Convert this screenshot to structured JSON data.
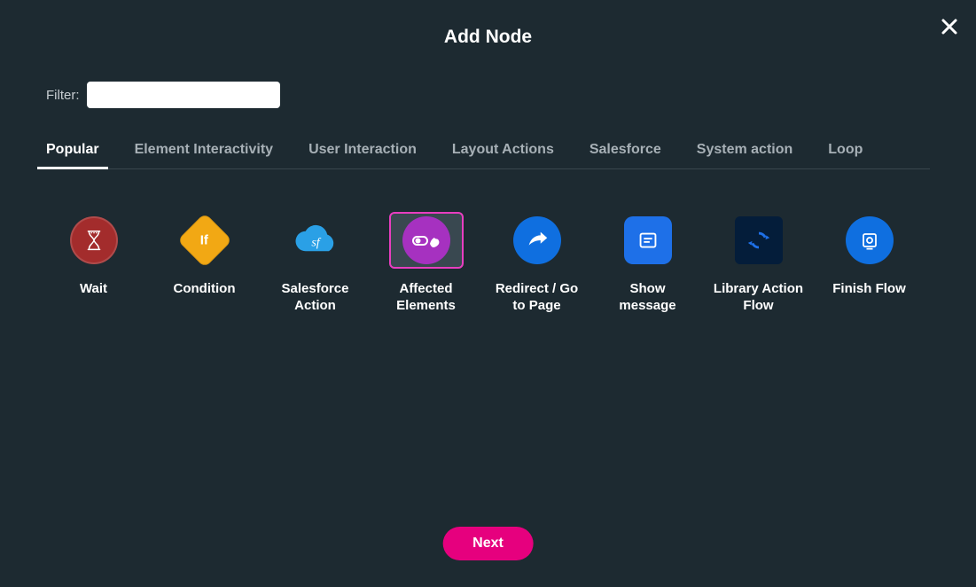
{
  "header": {
    "title": "Add Node"
  },
  "filter": {
    "label": "Filter:",
    "value": ""
  },
  "tabs": [
    {
      "id": "popular",
      "label": "Popular",
      "active": true
    },
    {
      "id": "element-interactivity",
      "label": "Element Interactivity",
      "active": false
    },
    {
      "id": "user-interaction",
      "label": "User Interaction",
      "active": false
    },
    {
      "id": "layout-actions",
      "label": "Layout Actions",
      "active": false
    },
    {
      "id": "salesforce",
      "label": "Salesforce",
      "active": false
    },
    {
      "id": "system-action",
      "label": "System action",
      "active": false
    },
    {
      "id": "loop",
      "label": "Loop",
      "active": false
    }
  ],
  "nodes": [
    {
      "id": "wait",
      "label": "Wait",
      "icon": "hourglass-icon",
      "selected": false
    },
    {
      "id": "condition",
      "label": "Condition",
      "icon": "branch-icon",
      "selected": false
    },
    {
      "id": "salesforce-action",
      "label": "Salesforce Action",
      "icon": "cloud-sf-icon",
      "selected": false
    },
    {
      "id": "affected-elements",
      "label": "Affected Elements",
      "icon": "hand-toggle-icon",
      "selected": true
    },
    {
      "id": "redirect",
      "label": "Redirect / Go to Page",
      "icon": "redirect-arrow-icon",
      "selected": false
    },
    {
      "id": "show-message",
      "label": "Show message",
      "icon": "message-lines-icon",
      "selected": false
    },
    {
      "id": "library-action-flow",
      "label": "Library Action Flow",
      "icon": "sync-arrows-icon",
      "selected": false
    },
    {
      "id": "finish-flow",
      "label": "Finish Flow",
      "icon": "stop-square-icon",
      "selected": false
    }
  ],
  "footer": {
    "next_label": "Next"
  },
  "colors": {
    "background": "#1d2a31",
    "accent": "#e6007e",
    "selected_border": "#e83ec0",
    "tab_inactive": "#a7b0b6"
  }
}
